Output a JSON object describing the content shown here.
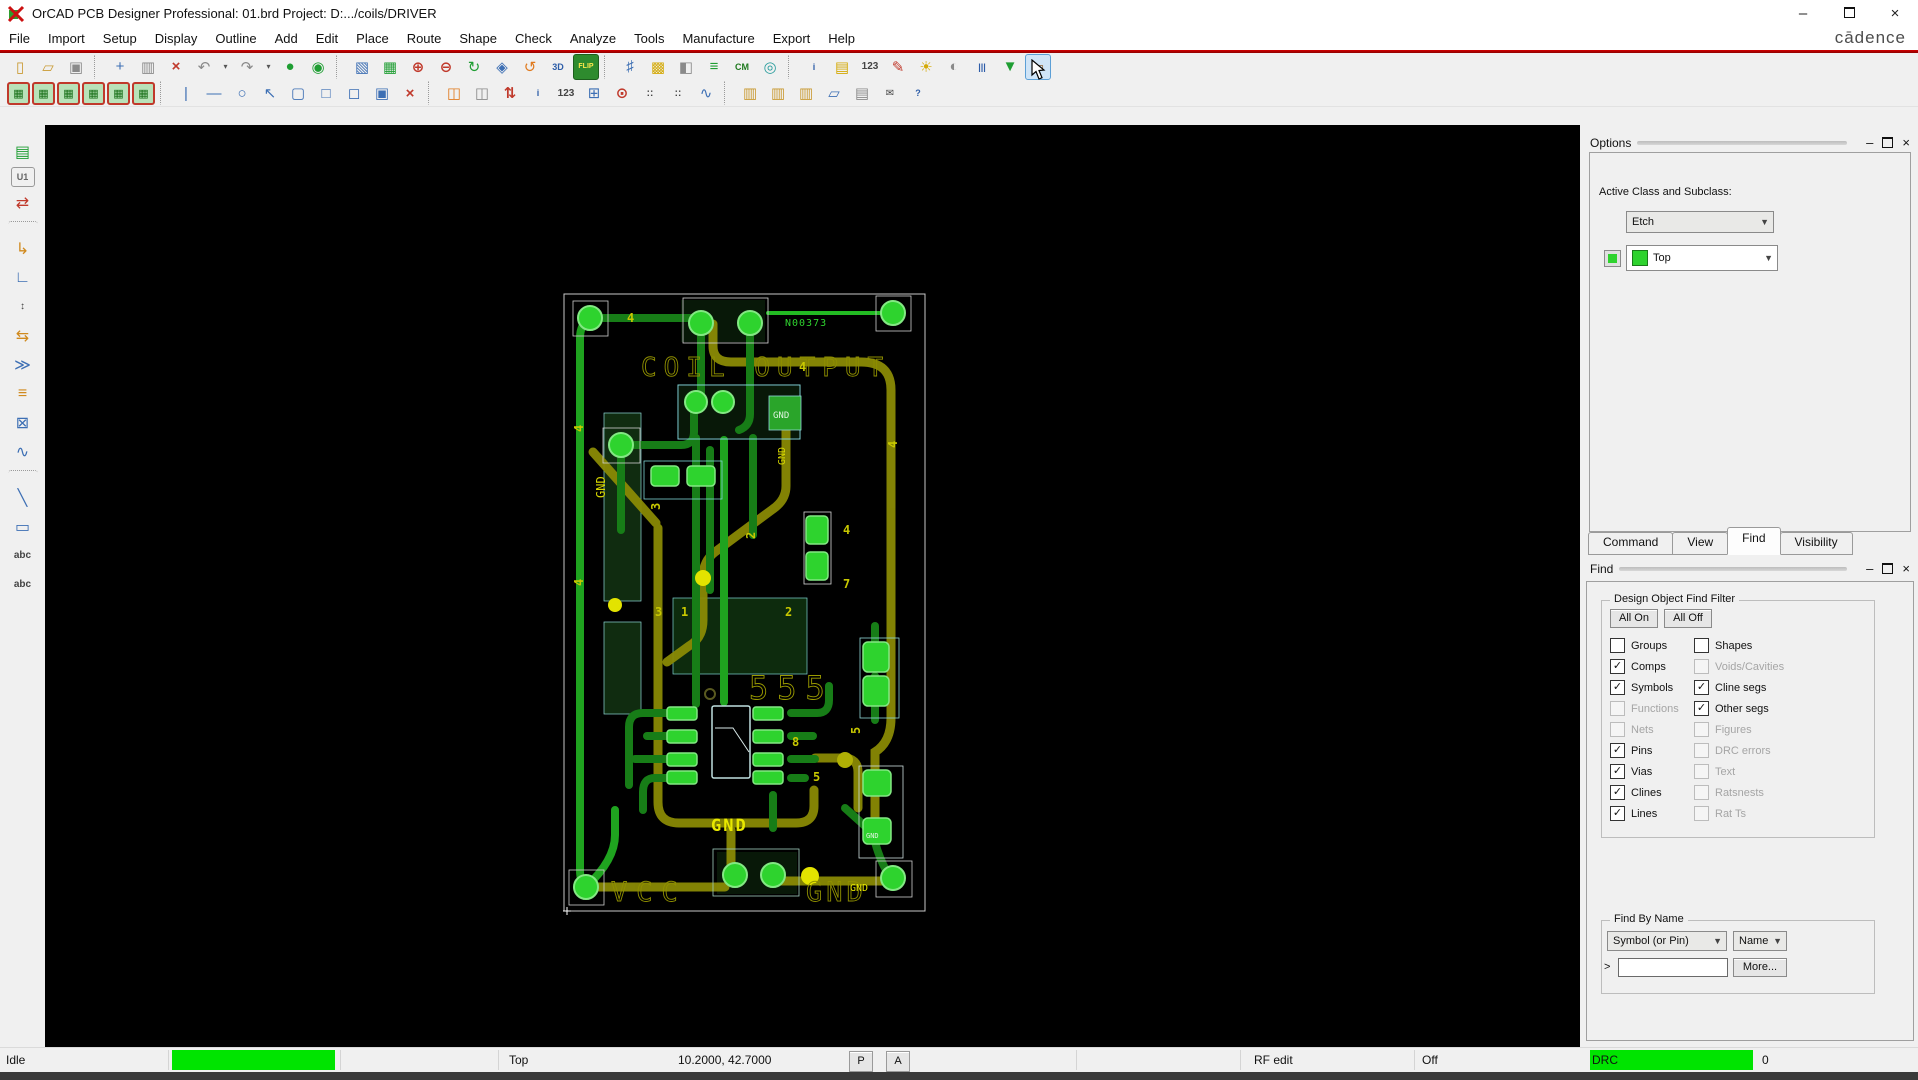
{
  "window": {
    "title": "OrCAD PCB Designer Professional: 01.brd  Project: D:.../coils/DRIVER",
    "brand": "cādence",
    "minimize": "–",
    "maximize": "",
    "close": "×"
  },
  "menus": [
    "File",
    "Import",
    "Setup",
    "Display",
    "Outline",
    "Add",
    "Edit",
    "Place",
    "Route",
    "Shape",
    "Check",
    "Analyze",
    "Tools",
    "Manufacture",
    "Export",
    "Help"
  ],
  "toolbar_row1": [
    {
      "name": "new-file-button",
      "glyph": "▯",
      "tone": "tan",
      "inter": "true"
    },
    {
      "name": "open-folder-button",
      "glyph": "▱",
      "tone": "tan",
      "inter": "true"
    },
    {
      "name": "save-button",
      "glyph": "▣",
      "tone": "gray",
      "inter": "true"
    },
    {
      "name": "separator",
      "glyph": "",
      "tone": "sep",
      "inter": "false"
    },
    {
      "name": "move-button",
      "glyph": "+",
      "tone": "blue",
      "inter": "true"
    },
    {
      "name": "copy-button",
      "glyph": "▥",
      "tone": "gray",
      "inter": "true"
    },
    {
      "name": "delete-button",
      "glyph": "×",
      "tone": "red",
      "inter": "true"
    },
    {
      "name": "undo-button",
      "glyph": "↶",
      "tone": "gray",
      "inter": "true"
    },
    {
      "name": "undo-dropdown",
      "glyph": "▾",
      "tone": "dd",
      "inter": "true"
    },
    {
      "name": "redo-button",
      "glyph": "↷",
      "tone": "gray",
      "inter": "true"
    },
    {
      "name": "redo-dropdown",
      "glyph": "▾",
      "tone": "dd",
      "inter": "true"
    },
    {
      "name": "fix-button",
      "glyph": "●",
      "tone": "green",
      "inter": "true"
    },
    {
      "name": "pin-button",
      "glyph": "◉",
      "tone": "green",
      "inter": "true"
    },
    {
      "name": "separator",
      "glyph": "",
      "tone": "sep",
      "inter": "false"
    },
    {
      "name": "zoom-points-button",
      "glyph": "▧",
      "tone": "blue",
      "inter": "true"
    },
    {
      "name": "zoom-grid-button",
      "glyph": "▦",
      "tone": "green",
      "inter": "true"
    },
    {
      "name": "zoom-in-button",
      "glyph": "⊕",
      "tone": "red",
      "inter": "true"
    },
    {
      "name": "zoom-out-button",
      "glyph": "⊖",
      "tone": "red",
      "inter": "true"
    },
    {
      "name": "redraw-button",
      "glyph": "↻",
      "tone": "green",
      "inter": "true"
    },
    {
      "name": "zoom-fit-button",
      "glyph": "◈",
      "tone": "blue",
      "inter": "true"
    },
    {
      "name": "unrectify-button",
      "glyph": "↺",
      "tone": "orange",
      "inter": "true"
    },
    {
      "name": "view-3d-button",
      "glyph": "3D",
      "tone": "txtb",
      "inter": "true"
    },
    {
      "name": "flip-design-button",
      "glyph": "FLIP",
      "tone": "flip",
      "inter": "true"
    },
    {
      "name": "separator",
      "glyph": "",
      "tone": "sep",
      "inter": "false"
    },
    {
      "name": "grid-toggle-button",
      "glyph": "♯",
      "tone": "blue",
      "inter": "true"
    },
    {
      "name": "color-dialog-button",
      "glyph": "▩",
      "tone": "yellow",
      "inter": "true"
    },
    {
      "name": "xsection-button",
      "glyph": "◧",
      "tone": "gray",
      "inter": "true"
    },
    {
      "name": "layer-select-button",
      "glyph": "≡",
      "tone": "green",
      "inter": "true"
    },
    {
      "name": "cm-table-button",
      "glyph": "CM",
      "tone": "txtg",
      "inter": "true"
    },
    {
      "name": "world-view-button",
      "glyph": "◎",
      "tone": "teal",
      "inter": "true"
    },
    {
      "name": "separator",
      "glyph": "",
      "tone": "sep",
      "inter": "false"
    },
    {
      "name": "show-element-button",
      "glyph": "i",
      "tone": "txtb",
      "inter": "true"
    },
    {
      "name": "element-info-button",
      "glyph": "▤",
      "tone": "yellow",
      "inter": "true"
    },
    {
      "name": "measure-button",
      "glyph": "123",
      "tone": "dark",
      "inter": "true"
    },
    {
      "name": "dehilight-button",
      "glyph": "✎",
      "tone": "red",
      "inter": "true"
    },
    {
      "name": "shine-mode-button",
      "glyph": "☀",
      "tone": "yellow",
      "inter": "true"
    },
    {
      "name": "shadow-mode-button",
      "glyph": "◐",
      "tone": "gray",
      "inter": "true"
    },
    {
      "name": "waive-drc-button",
      "glyph": "|||",
      "tone": "txtb",
      "inter": "true"
    },
    {
      "name": "filter-funnel-button",
      "glyph": "▼",
      "tone": "green",
      "inter": "true"
    },
    {
      "name": "highlight-select-button",
      "glyph": "▭",
      "tone": "hover",
      "inter": "true"
    }
  ],
  "toolbar_row2": [
    {
      "name": "shape-add-button",
      "glyph": "▦",
      "tone": "board",
      "inter": "true"
    },
    {
      "name": "shape-edit-button",
      "glyph": "▦",
      "tone": "board",
      "inter": "true"
    },
    {
      "name": "shape-select-button",
      "glyph": "▦",
      "tone": "board",
      "inter": "true"
    },
    {
      "name": "shape-delete-button",
      "glyph": "▦",
      "tone": "board",
      "inter": "true"
    },
    {
      "name": "shape-void-button",
      "glyph": "▦",
      "tone": "board",
      "inter": "true"
    },
    {
      "name": "shape-merge-button",
      "glyph": "▦",
      "tone": "board",
      "inter": "true"
    },
    {
      "name": "separator",
      "glyph": "",
      "tone": "sep",
      "inter": "false"
    },
    {
      "name": "add-pin-button",
      "glyph": "|",
      "tone": "blue",
      "inter": "true"
    },
    {
      "name": "add-line-segment-button",
      "glyph": "—",
      "tone": "blue",
      "inter": "true"
    },
    {
      "name": "add-circle-button",
      "glyph": "○",
      "tone": "blue",
      "inter": "true"
    },
    {
      "name": "select-tool-button",
      "glyph": "↖",
      "tone": "blue",
      "inter": "true"
    },
    {
      "name": "add-rounded-rect-button",
      "glyph": "▢",
      "tone": "blue",
      "inter": "true"
    },
    {
      "name": "add-rect-button",
      "glyph": "□",
      "tone": "blue",
      "inter": "true"
    },
    {
      "name": "add-frame-rect-button",
      "glyph": "◻",
      "tone": "blue",
      "inter": "true"
    },
    {
      "name": "add-filled-rect-button",
      "glyph": "▣",
      "tone": "blue",
      "inter": "true"
    },
    {
      "name": "delete-element-button",
      "glyph": "×",
      "tone": "red",
      "inter": "true"
    },
    {
      "name": "separator",
      "glyph": "",
      "tone": "sep",
      "inter": "false"
    },
    {
      "name": "create-via-button",
      "glyph": "◫",
      "tone": "orange",
      "inter": "true"
    },
    {
      "name": "pad-edit-button",
      "glyph": "◫",
      "tone": "gray",
      "inter": "true"
    },
    {
      "name": "align-vertical-button",
      "glyph": "⇅",
      "tone": "red",
      "inter": "true"
    },
    {
      "name": "show-measure-button",
      "glyph": "i",
      "tone": "txtb",
      "inter": "true"
    },
    {
      "name": "assign-number-button",
      "glyph": "123",
      "tone": "dark",
      "inter": "true"
    },
    {
      "name": "spacing-grid-button",
      "glyph": "⊞",
      "tone": "blue",
      "inter": "true"
    },
    {
      "name": "snap-point-button",
      "glyph": "⊙",
      "tone": "red",
      "inter": "true"
    },
    {
      "name": "array-dots-button",
      "glyph": "::",
      "tone": "dark",
      "inter": "true"
    },
    {
      "name": "array-dots-2-button",
      "glyph": "::",
      "tone": "dark",
      "inter": "true"
    },
    {
      "name": "signal-probe-button",
      "glyph": "∿",
      "tone": "blue",
      "inter": "true"
    },
    {
      "name": "separator",
      "glyph": "",
      "tone": "sep",
      "inter": "false"
    },
    {
      "name": "place-manual-button",
      "glyph": "▥",
      "tone": "tan",
      "inter": "true"
    },
    {
      "name": "place-module-button",
      "glyph": "▥",
      "tone": "tan",
      "inter": "true"
    },
    {
      "name": "place-refdes-button",
      "glyph": "▥",
      "tone": "tan",
      "inter": "true"
    },
    {
      "name": "copy-window-button",
      "glyph": "▱",
      "tone": "blue",
      "inter": "true"
    },
    {
      "name": "film-record-button",
      "glyph": "▤",
      "tone": "gray",
      "inter": "true"
    },
    {
      "name": "mail-report-button",
      "glyph": "✉",
      "tone": "dark",
      "inter": "true"
    },
    {
      "name": "help-button",
      "glyph": "?",
      "tone": "txtb",
      "inter": "true"
    }
  ],
  "left_toolbar": [
    {
      "name": "import-logic-button",
      "glyph": "▤",
      "tone": "green",
      "inter": "true"
    },
    {
      "name": "place-component-button",
      "glyph": "U1",
      "tone": "gray",
      "inter": "true"
    },
    {
      "name": "swap-component-button",
      "glyph": "⇄",
      "tone": "red",
      "inter": "true"
    },
    {
      "name": "separator",
      "glyph": "",
      "tone": "sep",
      "inter": "false"
    },
    {
      "name": "route-connect-button",
      "glyph": "↳",
      "tone": "orange",
      "inter": "true"
    },
    {
      "name": "edit-boundary-button",
      "glyph": "∟",
      "tone": "blue",
      "inter": "true"
    },
    {
      "name": "delay-tune-button",
      "glyph": "↕",
      "tone": "dark",
      "inter": "true"
    },
    {
      "name": "pin-swap-button",
      "glyph": "⇆",
      "tone": "orange",
      "inter": "true"
    },
    {
      "name": "fanout-button",
      "glyph": "≫",
      "tone": "blue",
      "inter": "true"
    },
    {
      "name": "align-components-button",
      "glyph": "≡",
      "tone": "orange",
      "inter": "true"
    },
    {
      "name": "spread-button",
      "glyph": "⊠",
      "tone": "blue",
      "inter": "true"
    },
    {
      "name": "meander-button",
      "glyph": "∿",
      "tone": "blue",
      "inter": "true"
    },
    {
      "name": "separator",
      "glyph": "",
      "tone": "sep",
      "inter": "false"
    },
    {
      "name": "add-line-button",
      "glyph": "╲",
      "tone": "blue",
      "inter": "true"
    },
    {
      "name": "add-rectangle-button",
      "glyph": "▭",
      "tone": "blue",
      "inter": "true"
    },
    {
      "name": "add-text-button",
      "glyph": "abc",
      "tone": "dark",
      "inter": "true"
    },
    {
      "name": "edit-text-button",
      "glyph": "abc",
      "tone": "dark",
      "inter": "true"
    }
  ],
  "options_panel": {
    "title": "Options",
    "active_class_label": "Active Class and Subclass:",
    "class_value": "Etch",
    "subclass_value": "Top",
    "minimize": "–",
    "close": "×",
    "chevron": "▼"
  },
  "tabs": {
    "items": [
      "Command",
      "View",
      "Find",
      "Visibility"
    ],
    "active": "Find"
  },
  "find_panel": {
    "title": "Find",
    "minimize": "–",
    "close": "×",
    "filter_legend": "Design Object Find Filter",
    "all_on": "All On",
    "all_off": "All Off",
    "filter_left": [
      {
        "label": "Groups",
        "mark": "",
        "state": "off",
        "inter": "true"
      },
      {
        "label": "Comps",
        "mark": "✓",
        "state": "on",
        "inter": "true"
      },
      {
        "label": "Symbols",
        "mark": "✓",
        "state": "on",
        "inter": "true"
      },
      {
        "label": "Functions",
        "mark": "",
        "state": "disabled",
        "inter": "false"
      },
      {
        "label": "Nets",
        "mark": "",
        "state": "disabled",
        "inter": "false"
      },
      {
        "label": "Pins",
        "mark": "✓",
        "state": "on",
        "inter": "true"
      },
      {
        "label": "Vias",
        "mark": "✓",
        "state": "on",
        "inter": "true"
      },
      {
        "label": "Clines",
        "mark": "✓",
        "state": "on",
        "inter": "true"
      },
      {
        "label": "Lines",
        "mark": "✓",
        "state": "on",
        "inter": "true"
      }
    ],
    "filter_right": [
      {
        "label": "Shapes",
        "mark": "",
        "state": "off",
        "inter": "true"
      },
      {
        "label": "Voids/Cavities",
        "mark": "",
        "state": "disabled",
        "inter": "false"
      },
      {
        "label": "Cline segs",
        "mark": "✓",
        "state": "on",
        "inter": "true"
      },
      {
        "label": "Other segs",
        "mark": "✓",
        "state": "on",
        "inter": "true"
      },
      {
        "label": "Figures",
        "mark": "",
        "state": "disabled",
        "inter": "false"
      },
      {
        "label": "DRC errors",
        "mark": "",
        "state": "disabled",
        "inter": "false"
      },
      {
        "label": "Text",
        "mark": "",
        "state": "disabled",
        "inter": "false"
      },
      {
        "label": "Ratsnests",
        "mark": "",
        "state": "disabled",
        "inter": "false"
      },
      {
        "label": "Rat Ts",
        "mark": "",
        "state": "disabled",
        "inter": "false"
      }
    ],
    "find_by_name_legend": "Find By Name",
    "name_type": "Symbol (or Pin)",
    "name_mode": "Name",
    "prompt": ">",
    "input_value": "",
    "more_label": "More..."
  },
  "canvas": {
    "board": {
      "net_label": "N00373",
      "silk_title": "COIL OUTPUT",
      "chip_label": "555",
      "vcc_label": "VCC",
      "gnd_label": "GND",
      "digits": [
        "4",
        "4",
        "4",
        "4",
        "4",
        "7",
        "3",
        "1",
        "2",
        "5",
        "5",
        "3",
        "8",
        "2"
      ]
    }
  },
  "status_bar": {
    "state": "Idle",
    "layer": "Top",
    "coords": "10.2000, 42.7000",
    "btn_p": "P",
    "btn_a": "A",
    "mode": "RF edit",
    "toggle": "Off",
    "drc_label": "DRC",
    "drc_count": "0"
  },
  "colors": {
    "trace_green": "#177d17",
    "trace_olive": "#8a8a05",
    "pad_green": "#2ed32e",
    "via_yellow": "#e3e300",
    "status_green": "#00e400",
    "accent_red": "#b40000"
  }
}
